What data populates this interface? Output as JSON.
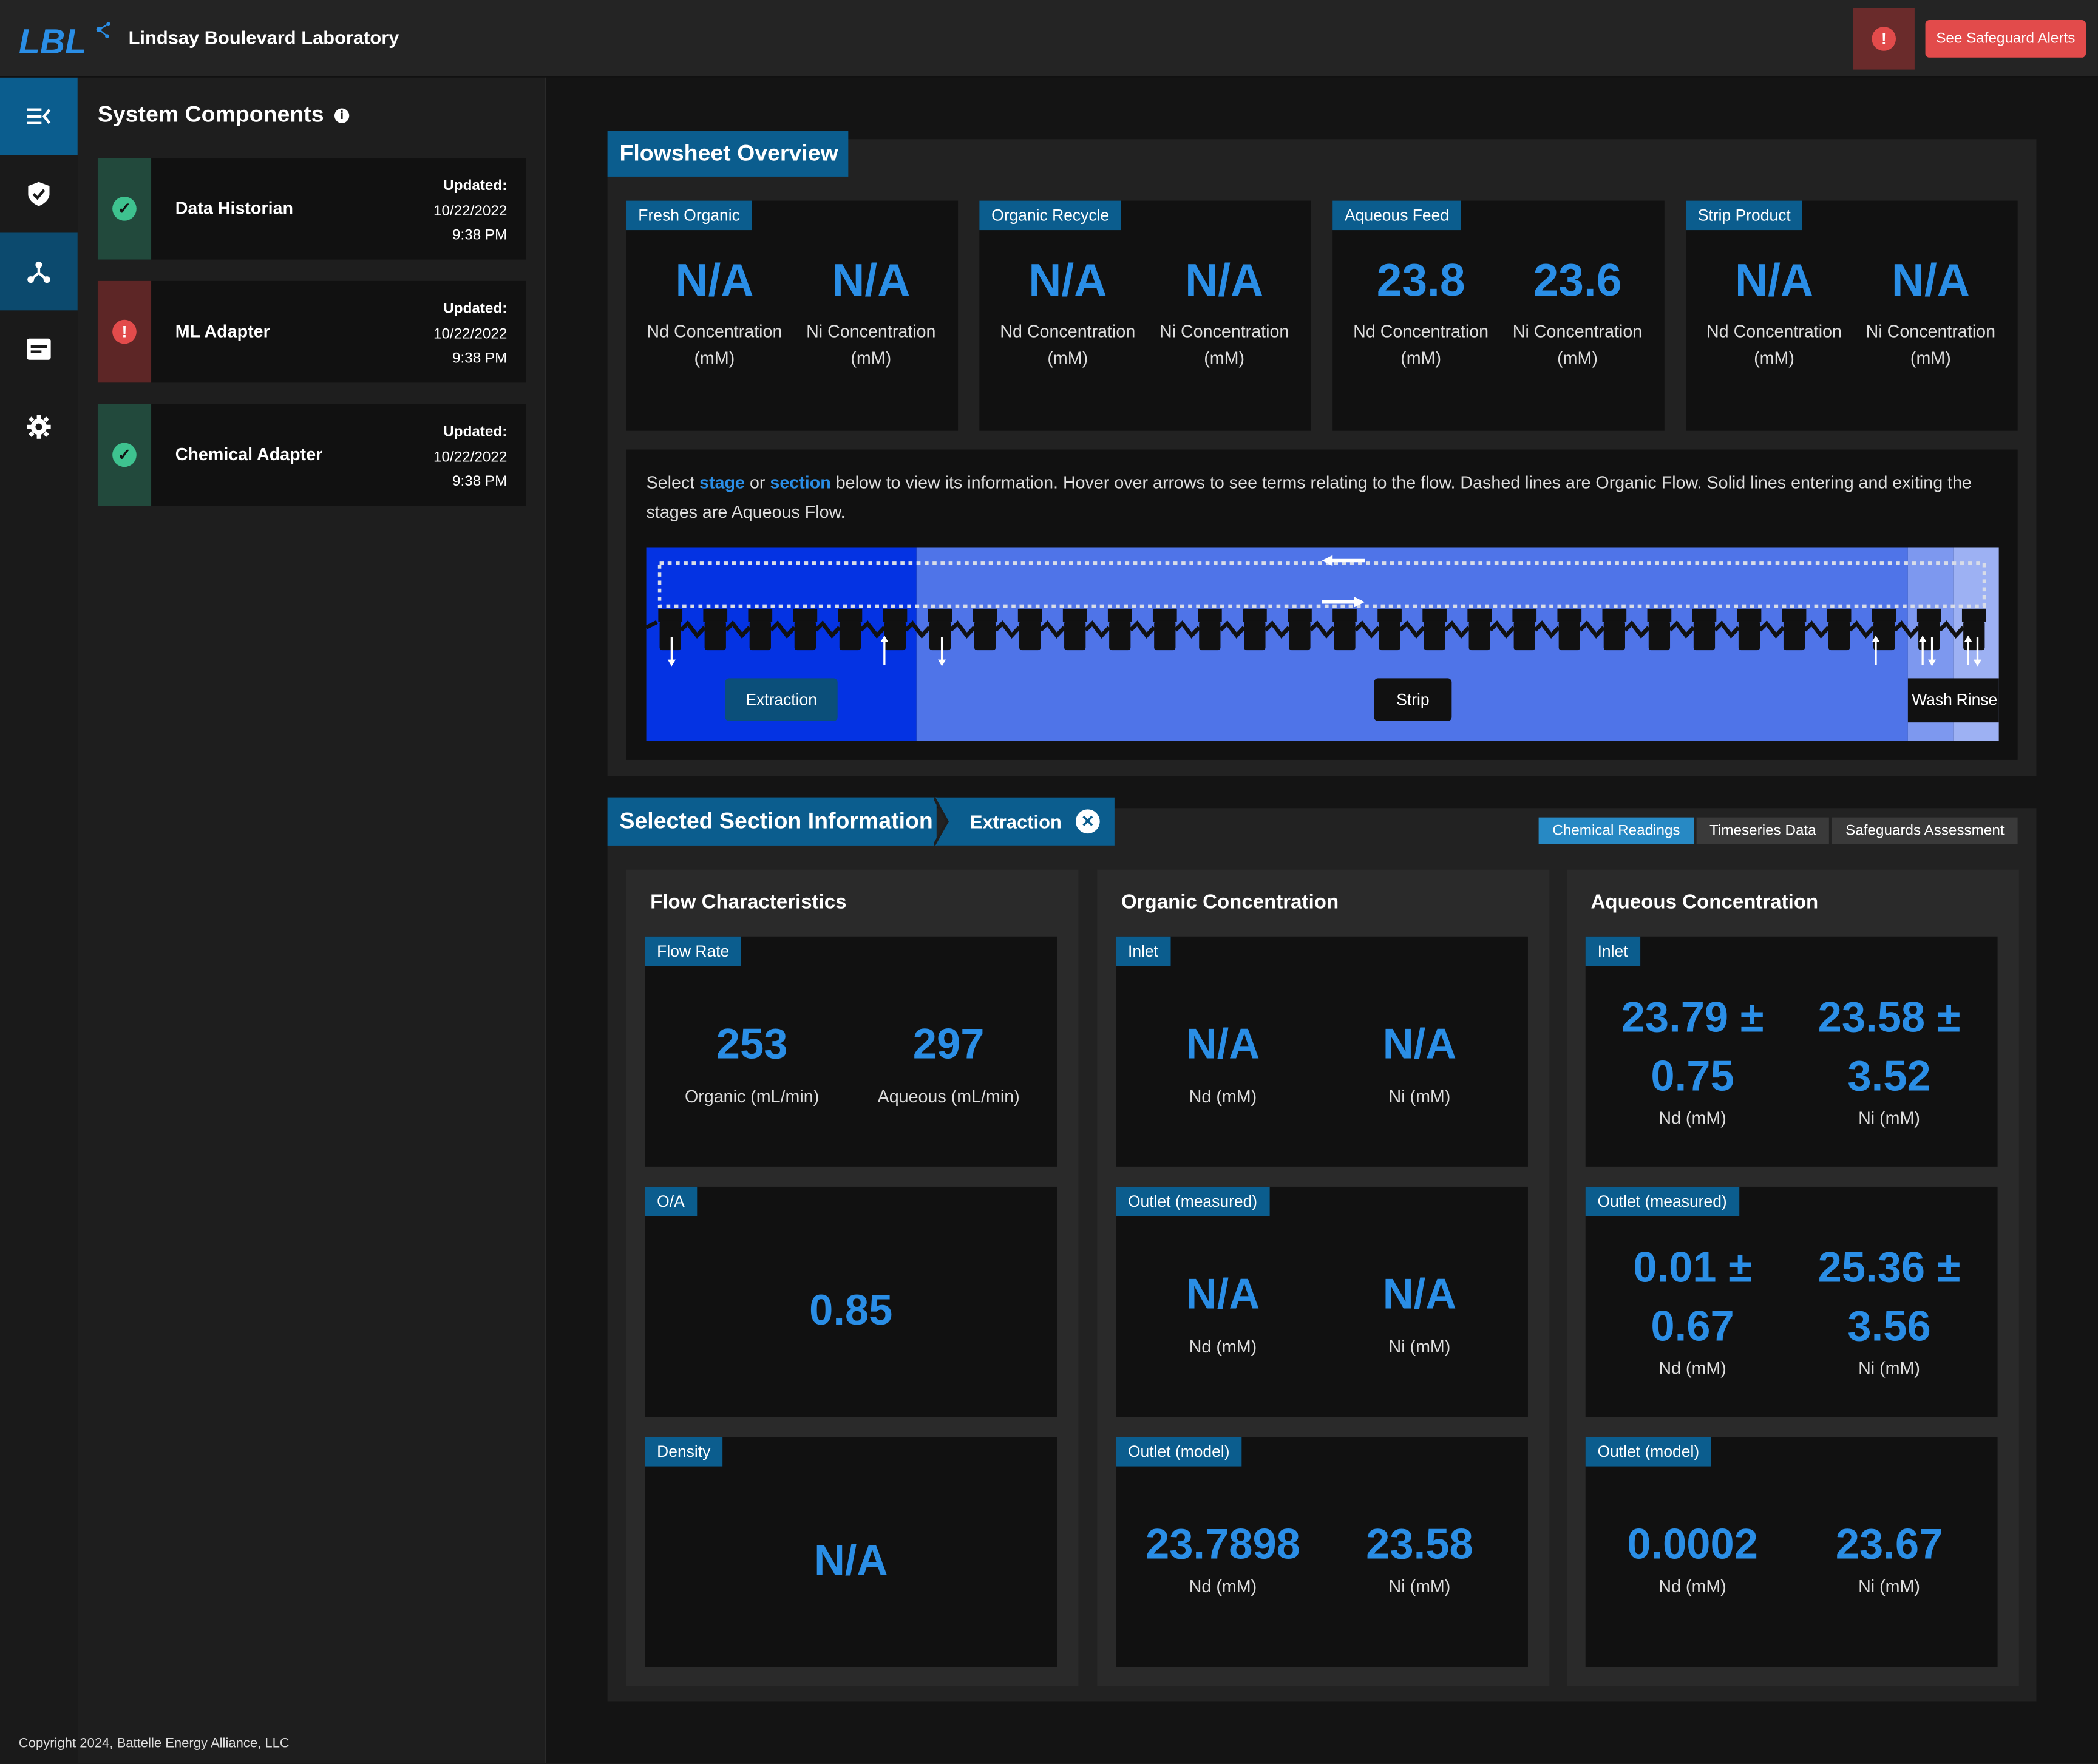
{
  "header": {
    "logo_text": "LBL",
    "app_title": "Lindsay Boulevard Laboratory",
    "alert_button": "See Safeguard Alerts",
    "alert_badge": "!"
  },
  "nav": {
    "items": [
      {
        "icon": "menu-collapse-icon"
      },
      {
        "icon": "shield-icon"
      },
      {
        "icon": "network-icon"
      },
      {
        "icon": "document-icon"
      },
      {
        "icon": "gear-icon"
      }
    ]
  },
  "system": {
    "title": "System Components",
    "components": [
      {
        "name": "Data Historian",
        "status": "ok",
        "updated_label": "Updated:",
        "date": "10/22/2022",
        "time": "9:38 PM"
      },
      {
        "name": "ML Adapter",
        "status": "error",
        "updated_label": "Updated:",
        "date": "10/22/2022",
        "time": "9:38 PM"
      },
      {
        "name": "Chemical Adapter",
        "status": "ok",
        "updated_label": "Updated:",
        "date": "10/22/2022",
        "time": "9:38 PM"
      }
    ]
  },
  "footer": {
    "copyright": "Copyright 2024, Battelle Energy Alliance, LLC"
  },
  "flowsheet": {
    "title": "Flowsheet Overview",
    "streams": [
      {
        "name": "Fresh Organic",
        "nd": "N/A",
        "nd_label": "Nd Concentration (mM)",
        "ni": "N/A",
        "ni_label": "Ni Concentration (mM)"
      },
      {
        "name": "Organic Recycle",
        "nd": "N/A",
        "nd_label": "Nd Concentration (mM)",
        "ni": "N/A",
        "ni_label": "Ni Concentration (mM)"
      },
      {
        "name": "Aqueous Feed",
        "nd": "23.8",
        "nd_label": "Nd Concentration (mM)",
        "ni": "23.6",
        "ni_label": "Ni Concentration (mM)"
      },
      {
        "name": "Strip Product",
        "nd": "N/A",
        "nd_label": "Nd Concentration (mM)",
        "ni": "N/A",
        "ni_label": "Ni Concentration (mM)"
      }
    ],
    "instructions": {
      "pre": "Select ",
      "stage": "stage",
      "mid": " or ",
      "section": "section",
      "post": " below to view its information. Hover over arrows to see terms relating to the flow. Dashed lines are Organic Flow. Solid lines entering and exiting the stages are Aqueous Flow."
    },
    "sections": {
      "extraction": "Extraction",
      "strip": "Strip",
      "wash": "Wash",
      "rinse": "Rinse"
    },
    "colors": {
      "extraction": "#0433e3",
      "strip": "#4f74e8",
      "wash": "#7d98ef"
    }
  },
  "selected": {
    "title": "Selected Section Information",
    "crumb": "Extraction",
    "tabs": [
      "Chemical Readings",
      "Timeseries Data",
      "Safeguards Assessment"
    ],
    "active_tab": "Chemical Readings",
    "flow": {
      "title": "Flow Characteristics",
      "flow_rate": {
        "label": "Flow Rate",
        "organic": "253",
        "organic_label": "Organic (mL/min)",
        "aqueous": "297",
        "aqueous_label": "Aqueous (mL/min)"
      },
      "oa": {
        "label": "O/A",
        "value": "0.85"
      },
      "density": {
        "label": "Density",
        "value": "N/A"
      }
    },
    "organic": {
      "title": "Organic Concentration",
      "inlet": {
        "label": "Inlet",
        "nd": "N/A",
        "ni": "N/A"
      },
      "outlet_measured": {
        "label": "Outlet (measured)",
        "nd": "N/A",
        "ni": "N/A"
      },
      "outlet_model": {
        "label": "Outlet (model)",
        "nd": "23.7898",
        "ni": "23.58"
      }
    },
    "aqueous": {
      "title": "Aqueous Concentration",
      "inlet": {
        "label": "Inlet",
        "nd_a": "23.79 ±",
        "nd_b": "0.75",
        "ni_a": "23.58 ±",
        "ni_b": "3.52"
      },
      "outlet_measured": {
        "label": "Outlet (measured)",
        "nd_a": "0.01 ±",
        "nd_b": "0.67",
        "ni_a": "25.36 ±",
        "ni_b": "3.56"
      },
      "outlet_model": {
        "label": "Outlet (model)",
        "nd": "0.0002",
        "ni": "23.67"
      }
    },
    "nd_unit": "Nd (mM)",
    "ni_unit": "Ni (mM)"
  }
}
